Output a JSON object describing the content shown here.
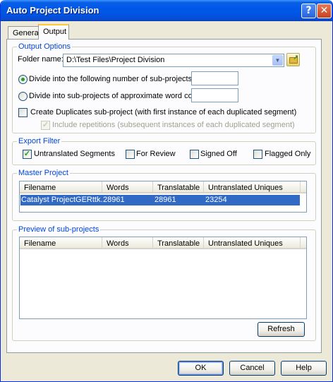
{
  "window": {
    "title": "Auto Project Division"
  },
  "tabs": [
    {
      "label": "General",
      "active": false
    },
    {
      "label": "Output",
      "active": true
    }
  ],
  "output_options": {
    "group_label": "Output Options",
    "folder_label": "Folder name:",
    "folder_value": "D:\\Test Files\\Project Division",
    "radio_count_label": "Divide into the following number of sub-projects:",
    "radio_count_value": "",
    "radio_wordcount_label": "Divide into sub-projects of approximate word count:",
    "radio_wordcount_value": "",
    "create_duplicates_label": "Create Duplicates sub-project (with first instance of each duplicated segment)",
    "include_repetitions_label": "Include repetitions (subsequent instances of each duplicated segment)"
  },
  "export_filter": {
    "group_label": "Export Filter",
    "items": [
      {
        "label": "Untranslated Segments",
        "checked": true
      },
      {
        "label": "For Review",
        "checked": false
      },
      {
        "label": "Signed Off",
        "checked": false
      },
      {
        "label": "Flagged Only",
        "checked": false
      }
    ]
  },
  "master_project": {
    "group_label": "Master Project",
    "columns": [
      "Filename",
      "Words",
      "Translatable",
      "Untranslated Uniques"
    ],
    "rows": [
      [
        "Catalyst ProjectGERttk....",
        "28961",
        "28961",
        "23254"
      ]
    ]
  },
  "preview": {
    "group_label": "Preview of sub-projects",
    "columns": [
      "Filename",
      "Words",
      "Translatable",
      "Untranslated Uniques"
    ],
    "refresh_label": "Refresh"
  },
  "footer": {
    "ok_label": "OK",
    "cancel_label": "Cancel",
    "help_label": "Help"
  },
  "titlebar_buttons": {
    "help_glyph": "?",
    "close_glyph": "✕"
  },
  "colors": {
    "accent": "#0054e3",
    "group_label": "#0046d5",
    "selection": "#316ac5"
  }
}
